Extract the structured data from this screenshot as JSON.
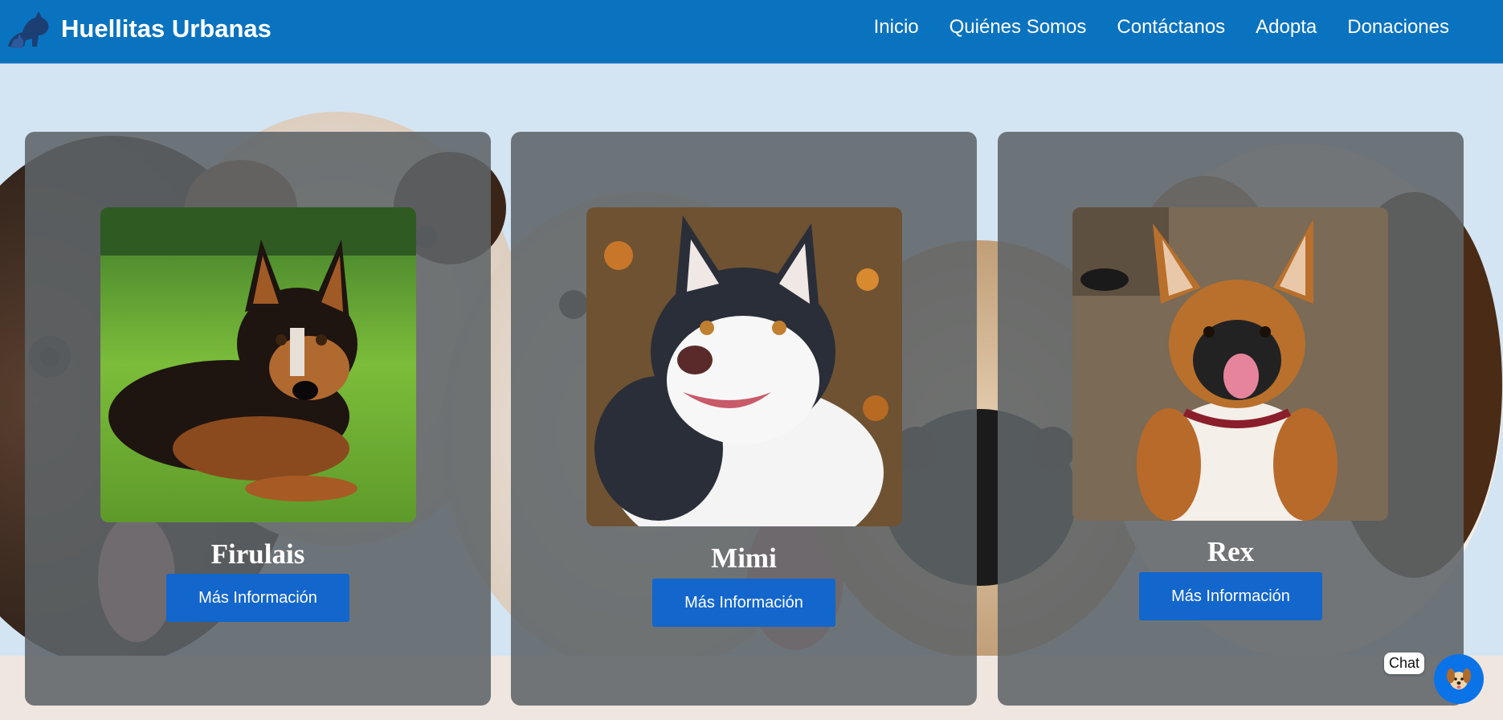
{
  "navbar": {
    "brand": "Huellitas Urbanas",
    "logo_icon": "dog-cat-logo-icon",
    "links": [
      {
        "label": "Inicio"
      },
      {
        "label": "Quiénes Somos"
      },
      {
        "label": "Contáctanos"
      },
      {
        "label": "Adopta"
      },
      {
        "label": "Donaciones"
      }
    ]
  },
  "cards": [
    {
      "name": "Firulais",
      "button_label": "Más Información",
      "photo": "firulais-dog-photo"
    },
    {
      "name": "Mimi",
      "button_label": "Más Información",
      "photo": "mimi-husky-photo"
    },
    {
      "name": "Rex",
      "button_label": "Más Información",
      "photo": "rex-dog-photo"
    }
  ],
  "chat": {
    "label": "Chat",
    "icon": "dog-face-icon"
  },
  "colors": {
    "navbar": "#0a73bf",
    "page_background": "#d3e4f3",
    "button": "#1366cc",
    "chat_button": "#0b73e8"
  }
}
